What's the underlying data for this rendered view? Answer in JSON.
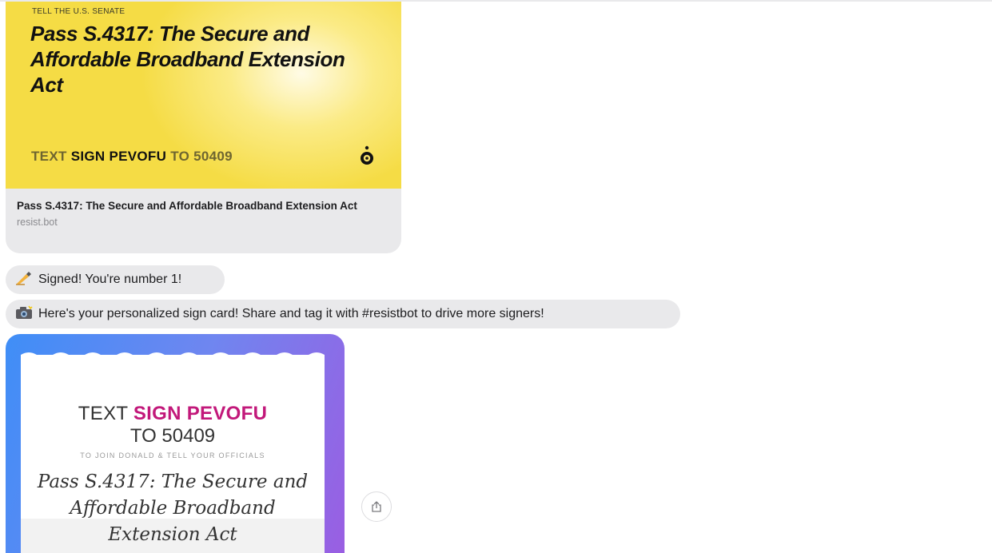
{
  "link_preview": {
    "eyebrow": "TELL THE U.S. SENATE",
    "headline": "Pass S.4317: The Secure and Affordable Broadband Extension Act",
    "cta_text": "TEXT",
    "cta_code": "SIGN PEVOFU",
    "cta_number": "TO 50409",
    "title": "Pass S.4317: The Secure and Affordable Broadband Extension Act",
    "domain": "resist.bot",
    "logo_icon": "resistbot-logo-icon"
  },
  "messages": [
    {
      "emoji": "writing-hand-icon",
      "text": "Signed! You're number 1!"
    },
    {
      "emoji": "camera-flash-icon",
      "text": "Here's your personalized sign card! Share and tag it with #resistbot to drive more signers!"
    }
  ],
  "sign_card": {
    "line1_prefix": "TEXT",
    "line1_code": "SIGN PEVOFU",
    "line2": "TO 50409",
    "small": "TO JOIN DONALD & TELL YOUR OFFICIALS",
    "title": "Pass S.4317: The Secure and Affordable Broadband Extension Act"
  },
  "share_button": {
    "icon": "share-icon"
  },
  "colors": {
    "bubble": "#e9e9eb",
    "accent_pink": "#c2187a",
    "yellow": "#f5dc45"
  }
}
